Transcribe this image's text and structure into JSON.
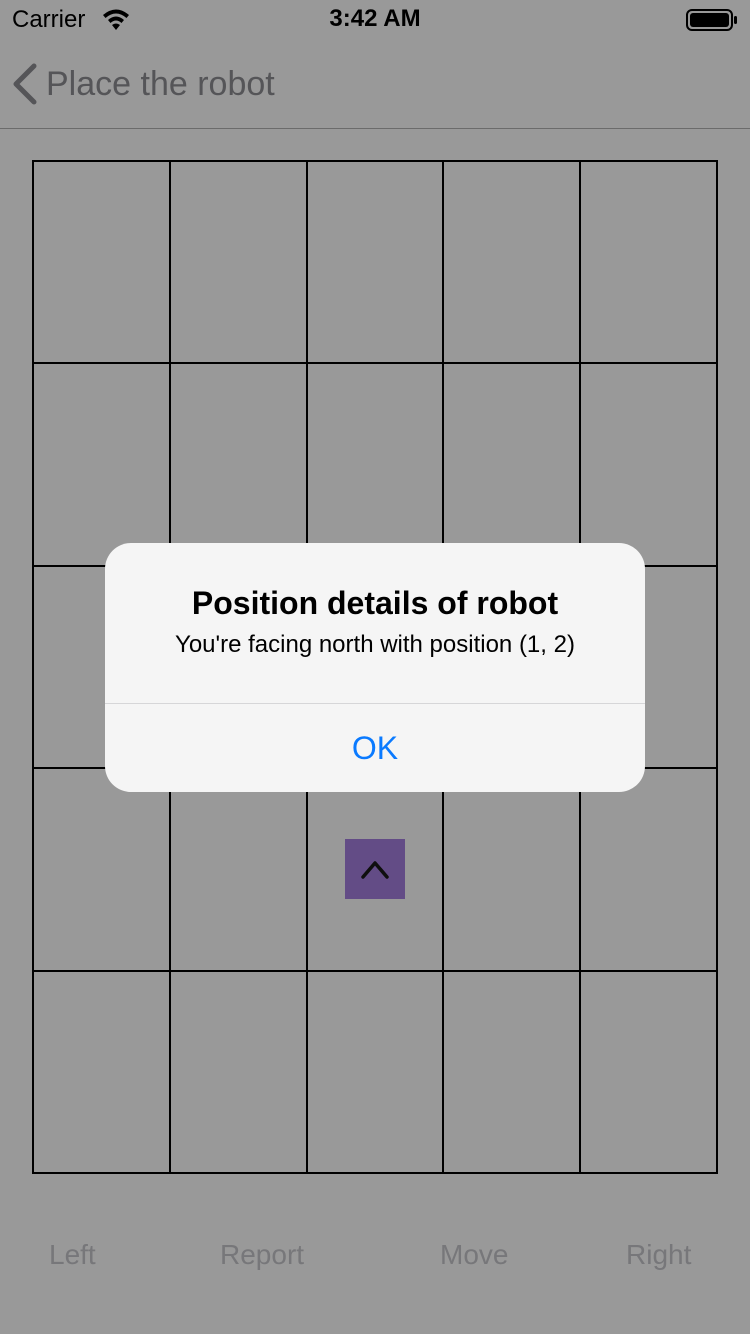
{
  "status_bar": {
    "carrier": "Carrier",
    "time": "3:42 AM",
    "wifi_icon": "wifi-icon",
    "battery_icon": "battery-icon"
  },
  "nav": {
    "back_icon": "chevron-left-icon",
    "title": "Place the robot"
  },
  "grid": {
    "columns": 5,
    "rows": 5
  },
  "robot": {
    "direction_icon": "chevron-up-icon",
    "color": "#a67fe0"
  },
  "controls": {
    "left_label": "Left",
    "report_label": "Report",
    "move_label": "Move",
    "right_label": "Right"
  },
  "alert": {
    "title": "Position details of robot",
    "message": "You're facing north with position (1, 2)",
    "ok_label": "OK",
    "ok_color": "#0a7aff"
  }
}
